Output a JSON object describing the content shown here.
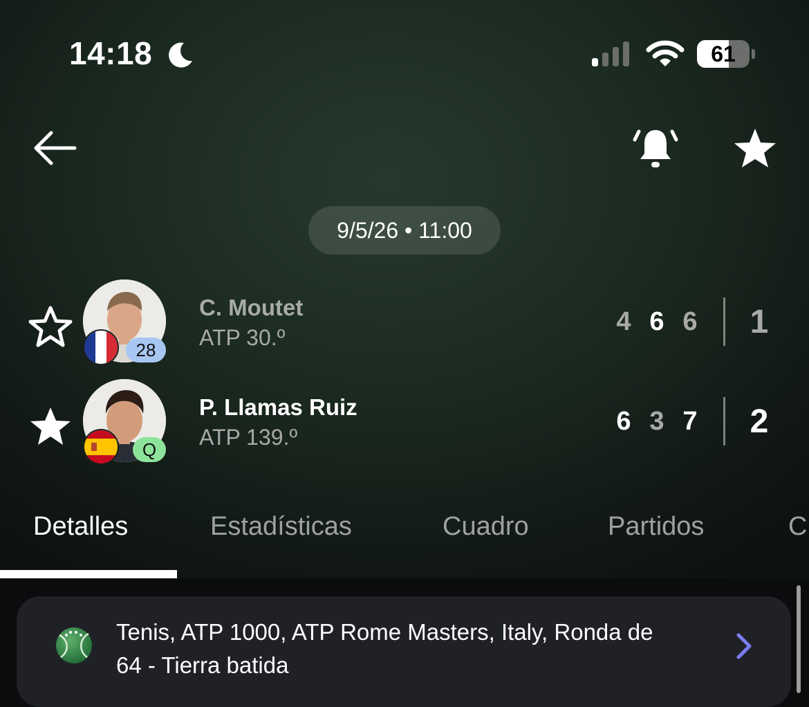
{
  "status_bar": {
    "time": "14:18",
    "battery_level": "61",
    "battery_fraction": 0.61,
    "icons": [
      "moon-icon",
      "cellular-signal-icon",
      "wifi-icon",
      "battery-icon"
    ]
  },
  "header": {
    "icons": [
      "back-arrow-icon",
      "bell-ringing-icon",
      "star-icon"
    ]
  },
  "match": {
    "datetime": "9/5/26 • 11:00",
    "players": [
      {
        "name": "C. Moutet",
        "ranking": "ATP 30.º",
        "badge": "28",
        "flag": "france",
        "favorite": false,
        "sets": [
          "4",
          "6",
          "6"
        ],
        "total": "1",
        "winner": false
      },
      {
        "name": "P. Llamas Ruiz",
        "ranking": "ATP 139.º",
        "badge": "Q",
        "flag": "spain",
        "favorite": true,
        "sets": [
          "6",
          "3",
          "7"
        ],
        "total": "2",
        "winner": true
      }
    ]
  },
  "tabs": [
    {
      "label": "Detalles",
      "active": true
    },
    {
      "label": "Estadísticas",
      "active": false
    },
    {
      "label": "Cuadro",
      "active": false
    },
    {
      "label": "Partidos",
      "active": false
    },
    {
      "label": "C",
      "active": false
    }
  ],
  "tournament_card": {
    "line1": "Tenis, ATP 1000, ATP Rome Masters, Italy, Ronda de",
    "line2": "64 - Tierra batida",
    "icon": "tennis-ball-icon",
    "chevron_color": "#7b7df0"
  },
  "colors": {
    "background": "#0b0c0e",
    "muted_text": "#a8aaa8",
    "seed_badge": "#a7c7f2",
    "qualifier_badge": "#8ee39a",
    "card": "#1f2126"
  }
}
